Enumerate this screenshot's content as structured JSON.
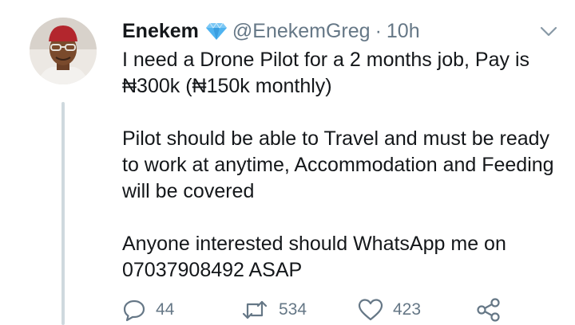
{
  "tweet": {
    "display_name": "Enekem",
    "handle": "@EnekemGreg",
    "separator": "·",
    "time": "10h",
    "lines": [
      "I need a Drone Pilot for a 2 months job, Pay is",
      "₦300k (₦150k monthly)",
      "",
      "Pilot should be able to Travel and must be ready",
      "to work at anytime, Accommodation and Feeding",
      "will be covered",
      "",
      "Anyone interested should WhatsApp me on",
      "07037908492 ASAP"
    ],
    "actions": {
      "reply_count": "44",
      "retweet_count": "534",
      "like_count": "423"
    }
  },
  "icons": {
    "verified": "verified-diamond-icon",
    "more": "chevron-down-icon",
    "reply": "reply-icon",
    "retweet": "retweet-icon",
    "like": "heart-icon",
    "share": "share-icon"
  },
  "colors": {
    "text": "#14171a",
    "secondary": "#657786",
    "thread_line": "#cfd9de",
    "verified": "#4fb3f0"
  }
}
